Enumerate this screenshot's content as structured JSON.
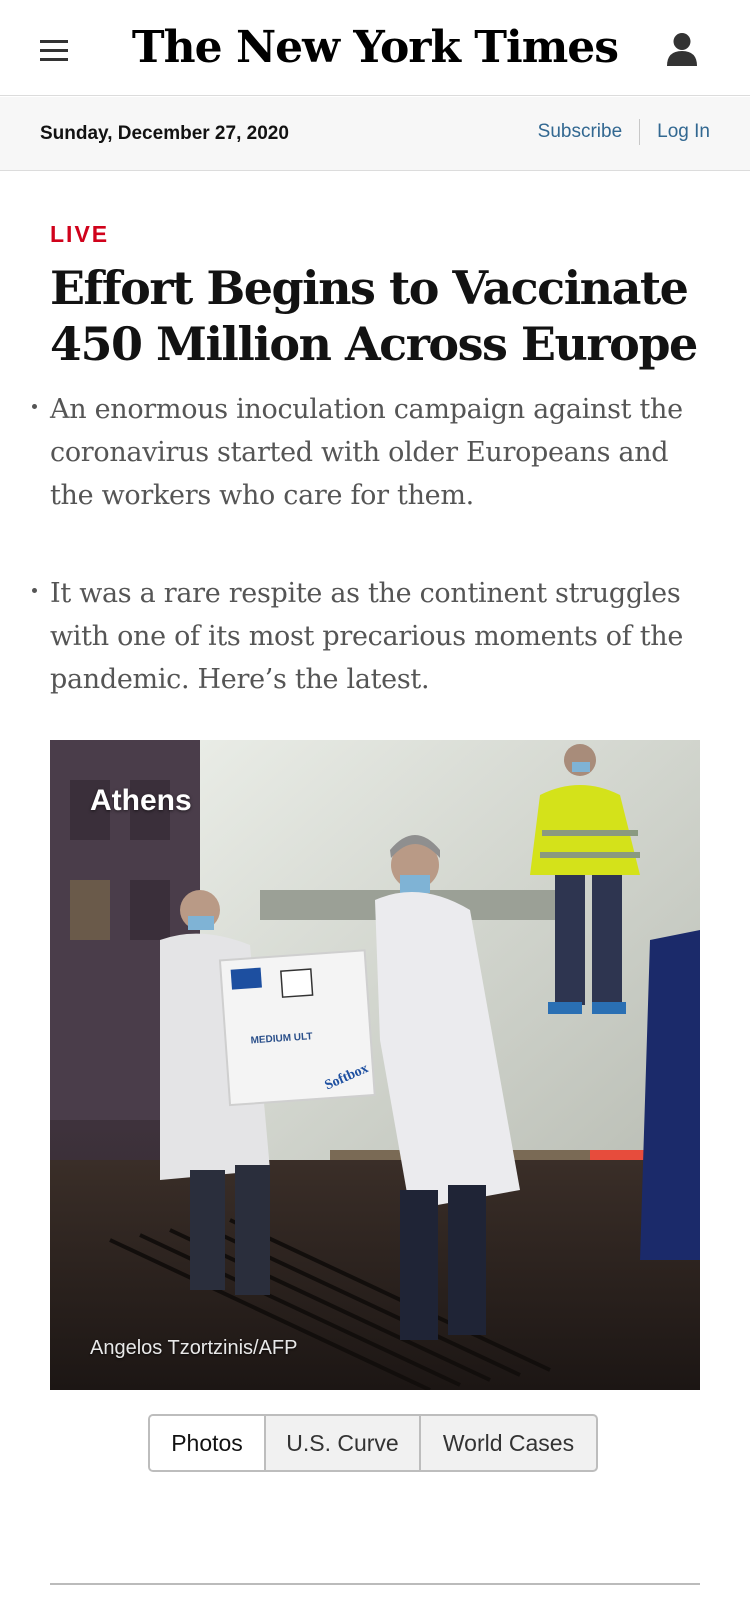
{
  "masthead": {
    "logo": "The New York Times",
    "menu_icon": "hamburger-menu-icon",
    "account_icon": "user-account-icon"
  },
  "datebar": {
    "date": "Sunday, December 27, 2020",
    "subscribe_label": "Subscribe",
    "login_label": "Log In"
  },
  "article": {
    "kicker": "LIVE",
    "headline": "Effort Begins to Vaccinate 450 Million Across Europe",
    "summary": [
      "An enormous inoculation campaign against the coronavirus started with older Europeans and the workers who care for them.",
      "It was a rare respite as the continent struggles with one of its most precarious moments of the pandemic. Here’s the latest."
    ],
    "photo": {
      "location_label": "Athens",
      "credit": "Angelos Tzortzinis/AFP",
      "box_text_1": "MEDIUM ULT",
      "box_text_2": "Softbox"
    }
  },
  "tabs": [
    {
      "label": "Photos",
      "active": true
    },
    {
      "label": "U.S. Curve",
      "active": false
    },
    {
      "label": "World Cases",
      "active": false
    }
  ],
  "colors": {
    "live_red": "#d0021b",
    "link_blue": "#326891",
    "summary_gray": "#555555"
  }
}
